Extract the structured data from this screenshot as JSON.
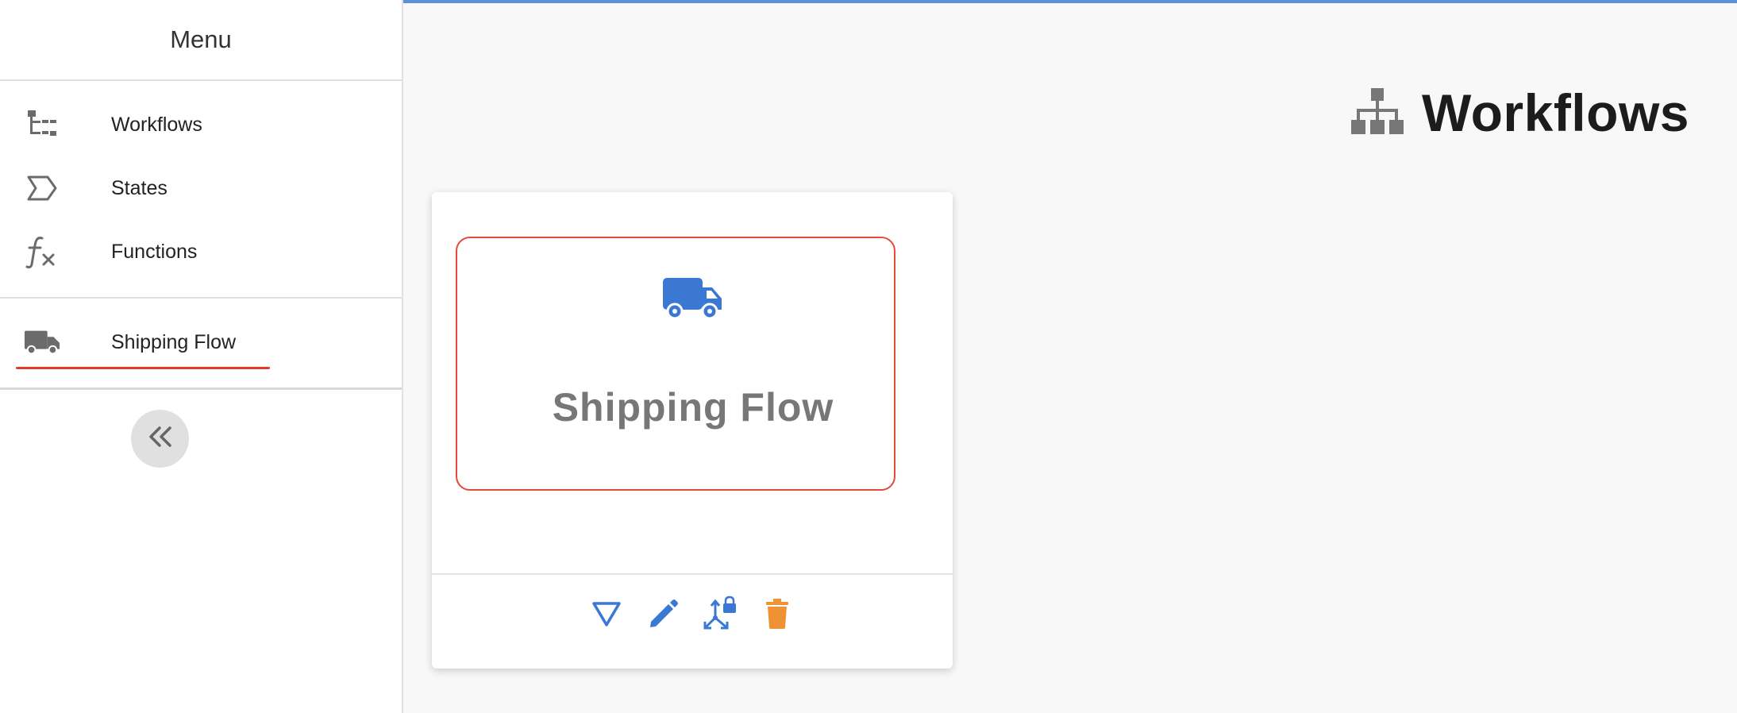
{
  "sidebar": {
    "title": "Menu",
    "items": [
      {
        "label": "Workflows",
        "icon": "workflow-tree-icon"
      },
      {
        "label": "States",
        "icon": "state-tag-icon"
      },
      {
        "label": "Functions",
        "icon": "function-fx-icon"
      }
    ],
    "active_item": {
      "label": "Shipping Flow",
      "icon": "truck-icon"
    },
    "collapse_icon": "double-chevron-left-icon"
  },
  "header": {
    "title": "Workflows",
    "icon": "sitemap-icon"
  },
  "card": {
    "name": "Shipping Flow",
    "icon": "truck-icon",
    "actions": [
      {
        "name": "filter",
        "icon": "triangle-down-icon"
      },
      {
        "name": "edit",
        "icon": "pencil-icon"
      },
      {
        "name": "permissions",
        "icon": "lock-branch-icon"
      },
      {
        "name": "delete",
        "icon": "trash-icon"
      }
    ]
  },
  "colors": {
    "accent_blue": "#3a78d4",
    "delete_orange": "#ef9233",
    "selection_red": "#e54a38",
    "icon_gray": "#6b6b6b"
  }
}
